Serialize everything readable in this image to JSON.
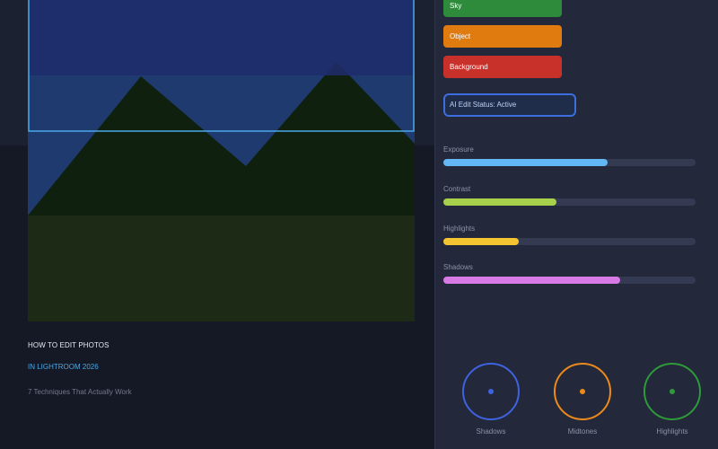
{
  "article": {
    "title": "HOW TO EDIT PHOTOS",
    "subtitle": "IN LIGHTROOM 2026",
    "tagline": "7 Techniques That Actually Work"
  },
  "masks": [
    {
      "label": "Sky",
      "color": "#2e8b3c"
    },
    {
      "label": "Object",
      "color": "#e07b0f"
    },
    {
      "label": "Background",
      "color": "#c8302a"
    }
  ],
  "status": {
    "label": "AI Edit Status: Active"
  },
  "sliders": [
    {
      "label": "Exposure",
      "value": 0.65,
      "color": "#62b7f4"
    },
    {
      "label": "Contrast",
      "value": 0.45,
      "color": "#a7d14a"
    },
    {
      "label": "Highlights",
      "value": 0.3,
      "color": "#f4c531"
    },
    {
      "label": "Shadows",
      "value": 0.7,
      "color": "#d87ae6"
    }
  ],
  "color_wheels": [
    {
      "label": "Shadows",
      "color": "#3f63e0"
    },
    {
      "label": "Midtones",
      "color": "#ec8a1b"
    },
    {
      "label": "Highlights",
      "color": "#2e9a3a"
    }
  ],
  "canvas": {
    "sky_color": "#1e3a6e",
    "mountain_color": "#10200f",
    "ground_color": "#1d2b16",
    "selection_color": "#4aa8e8"
  }
}
